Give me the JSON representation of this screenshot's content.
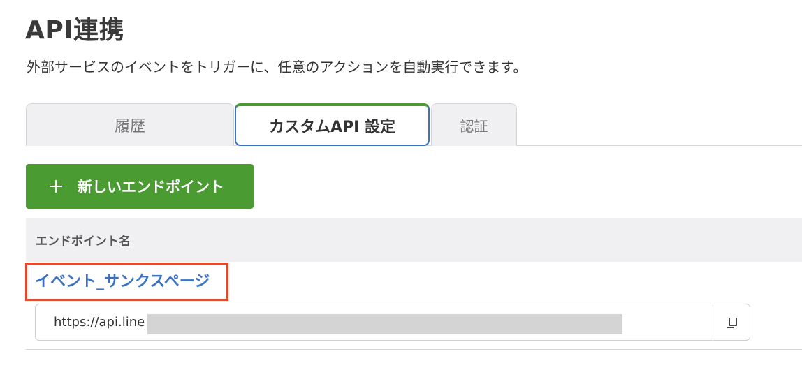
{
  "page": {
    "title": "API連携",
    "description": "外部サービスのイベントをトリガーに、任意のアクションを自動実行できます。"
  },
  "tabs": [
    {
      "label": "履歴",
      "active": false
    },
    {
      "label": "カスタムAPI 設定",
      "active": true
    },
    {
      "label": "認証",
      "active": false
    }
  ],
  "actions": {
    "new_endpoint_label": "新しいエンドポイント",
    "new_endpoint_icon": "plus-icon"
  },
  "table": {
    "header": "エンドポイント名",
    "rows": [
      {
        "name": "イベント_サンクスページ",
        "url_visible": "https://api.line",
        "url_redacted": true,
        "copy_icon": "copy-icon"
      }
    ]
  },
  "colors": {
    "primary_green": "#4a9b32",
    "link_blue": "#3b73c4",
    "highlight_red": "#e04a2f"
  }
}
